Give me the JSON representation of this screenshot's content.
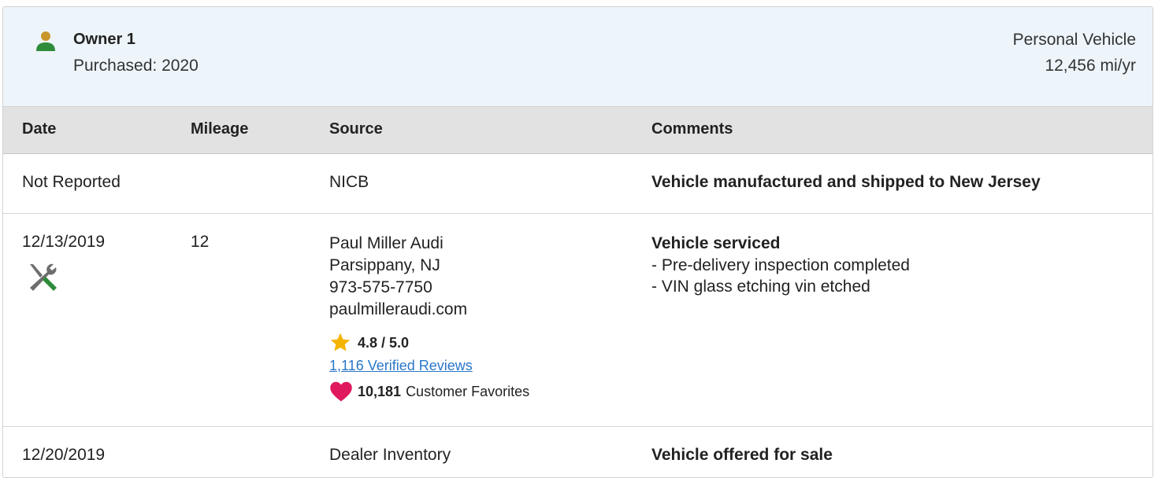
{
  "owner": {
    "title": "Owner 1",
    "purchased": "Purchased: 2020",
    "usage": "Personal Vehicle",
    "miles_per_year": "12,456 mi/yr",
    "icon": "person-icon",
    "icon_color": "#2e8b3a"
  },
  "table": {
    "headers": {
      "date": "Date",
      "mileage": "Mileage",
      "source": "Source",
      "comments": "Comments"
    },
    "rows": [
      {
        "date": "Not Reported",
        "mileage": "",
        "source": [
          "NICB"
        ],
        "comments_title": "Vehicle manufactured and shipped to New Jersey",
        "comments": []
      },
      {
        "date": "12/13/2019",
        "mileage": "12",
        "icon": "service-wrench-icon",
        "source": [
          "Paul Miller Audi",
          "Parsippany, NJ",
          "973-575-7750",
          "paulmilleraudi.com"
        ],
        "rating": "4.8 / 5.0",
        "reviews_link": "1,116 Verified Reviews",
        "favorites_count": "10,181",
        "favorites_label": "Customer Favorites",
        "comments_title": "Vehicle serviced",
        "comments": [
          "- Pre-delivery inspection completed",
          "- VIN glass etching vin etched"
        ]
      },
      {
        "date": "12/20/2019",
        "mileage": "",
        "source": [
          "Dealer Inventory"
        ],
        "comments_title": "Vehicle offered for sale",
        "comments": []
      }
    ]
  },
  "colors": {
    "header_bg": "#edf5fb",
    "table_header_bg": "#e2e2e2",
    "star": "#f5b400",
    "heart": "#e0195e",
    "link": "#2a77c9",
    "wrench_green": "#2e8b3a"
  }
}
